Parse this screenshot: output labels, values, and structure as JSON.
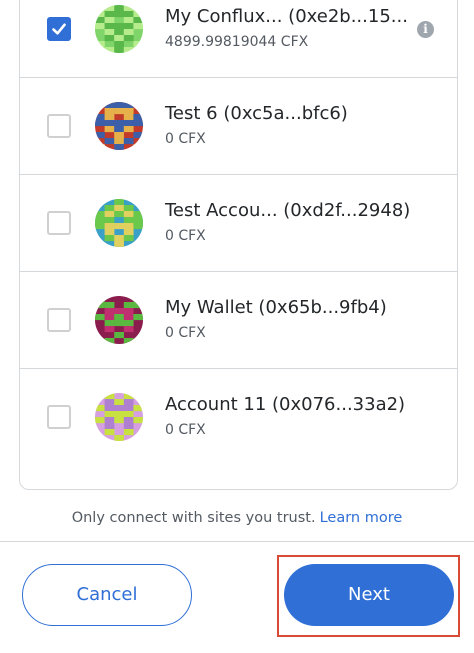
{
  "accounts": [
    {
      "name": "My Conflux... (0xe2b...15...",
      "balance": "4899.99819044 CFX",
      "checked": true,
      "show_info": true,
      "avatar_colors": [
        "#7fd46a",
        "#b6ec8c",
        "#5ab84a"
      ]
    },
    {
      "name": "Test 6 (0xc5a...bfc6)",
      "balance": "0 CFX",
      "checked": false,
      "show_info": false,
      "avatar_colors": [
        "#c23a2a",
        "#3b5fa8",
        "#e6b04a"
      ]
    },
    {
      "name": "Test Accou... (0xd2f...2948)",
      "balance": "0 CFX",
      "checked": false,
      "show_info": false,
      "avatar_colors": [
        "#3aa0c8",
        "#6ac84a",
        "#e0d060"
      ]
    },
    {
      "name": "My Wallet (0x65b...9fb4)",
      "balance": "0 CFX",
      "checked": false,
      "show_info": false,
      "avatar_colors": [
        "#8a1c4e",
        "#5ab840",
        "#c03070"
      ]
    },
    {
      "name": "Account 11 (0x076...33a2)",
      "balance": "0 CFX",
      "checked": false,
      "show_info": false,
      "avatar_colors": [
        "#d6a0e0",
        "#c8e040",
        "#b080d0"
      ]
    }
  ],
  "footer": {
    "trust_text": "Only connect with sites you trust.",
    "learn_more": "Learn more"
  },
  "actions": {
    "cancel_label": "Cancel",
    "next_label": "Next"
  },
  "colors": {
    "accent": "#2f6fd6",
    "highlight": "#d94a36",
    "border": "#d6d9dc"
  },
  "icons": {
    "checkbox_checked": "checkmark-icon",
    "info": "info-icon"
  }
}
